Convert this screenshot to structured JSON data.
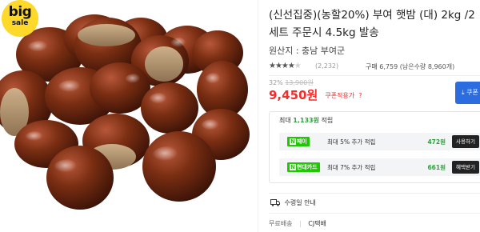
{
  "badge": {
    "line1": "big",
    "line2": "sale"
  },
  "product": {
    "title_line1": "(신선집중)(농할20%) 부여 햇밤 (대) 2kg /2",
    "title_line2": "세트 주문시 4.5kg 발송",
    "origin": "원산지 : 충남 부여군",
    "rating_stars": 4,
    "review_count": "(2,232)",
    "purchase_label": "구매",
    "purchase_count": "6,759",
    "purchase_note": "(남은수량 8,960개)"
  },
  "pricing": {
    "discount_rate": "32%",
    "original_price": "13,900원",
    "price": "9,450원",
    "coupon_label": "쿠폰적용가",
    "coupon_arrow": "?",
    "coupon_button": "쿠폰"
  },
  "benefits": {
    "header_prefix": "최대",
    "header_amount": "1,133원",
    "header_suffix": "적립",
    "rows": [
      {
        "logo": "페이",
        "desc": "최대 5% 추가 적립",
        "points": "472원",
        "action": "사용하기"
      },
      {
        "logo": "현대카드",
        "desc": "최대 7% 추가 적립",
        "points": "661원",
        "action": "혜택받기"
      }
    ]
  },
  "delivery": {
    "label": "수령일 안내",
    "shipping_fee": "무료배송",
    "carrier": "CJ택배"
  },
  "colors": {
    "price_red": "#f32c2c",
    "point_green": "#2e9f3d",
    "button_blue": "#2b6ddf",
    "badge_yellow": "#ffd92a",
    "chestnut_brown": "#7a2e12"
  }
}
